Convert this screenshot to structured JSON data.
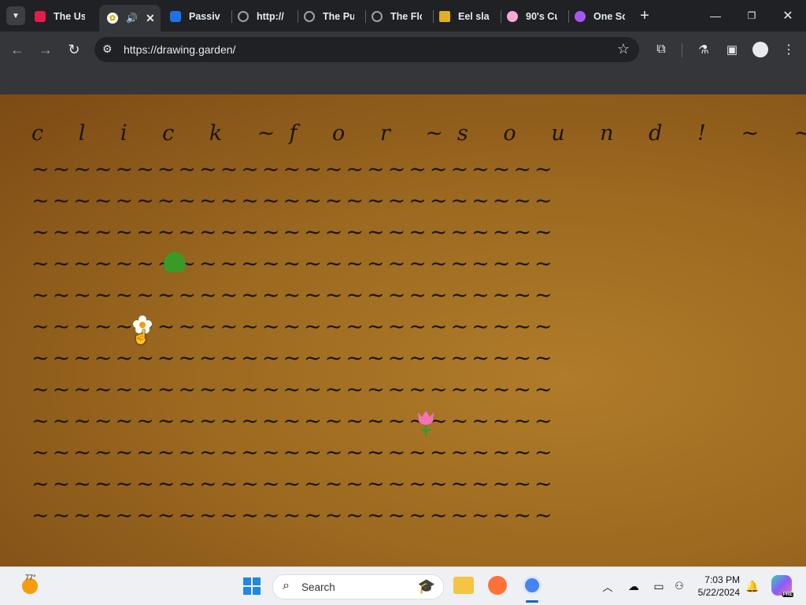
{
  "browser": {
    "tabs": [
      {
        "title": "The Us",
        "icon": "red-square-icon",
        "color": "#e11d48"
      },
      {
        "title": "",
        "icon": "flower-favicon-icon",
        "active": true
      },
      {
        "title": "Passive",
        "icon": "blue-face-icon",
        "color": "#1a73e8"
      },
      {
        "title": "http://",
        "icon": "globe-icon",
        "color": "#9aa0a6"
      },
      {
        "title": "The Pu",
        "icon": "globe-icon",
        "color": "#9aa0a6"
      },
      {
        "title": "The Flo",
        "icon": "globe-icon",
        "color": "#9aa0a6"
      },
      {
        "title": "Eel slap",
        "icon": "eel-icon",
        "color": "#e0b020"
      },
      {
        "title": "90's Cu",
        "icon": "mouse-icon",
        "color": "#f9a8d4"
      },
      {
        "title": "One So",
        "icon": "planet-icon",
        "color": "#a855f7"
      }
    ],
    "url": "https://drawing.garden/"
  },
  "page": {
    "heading_line": "c l i c k ~f o r ~s o u n d ! ~ ~ ~ ~ ~ ~ ~ ~",
    "wave_line": "~~~~~~~~~~~~~~~~~~~~~~~~~"
  },
  "taskbar": {
    "weather_temp": "77°",
    "search_label": "Search",
    "time": "7:03 PM",
    "date": "5/22/2024",
    "copilot_badge": "PRE"
  }
}
